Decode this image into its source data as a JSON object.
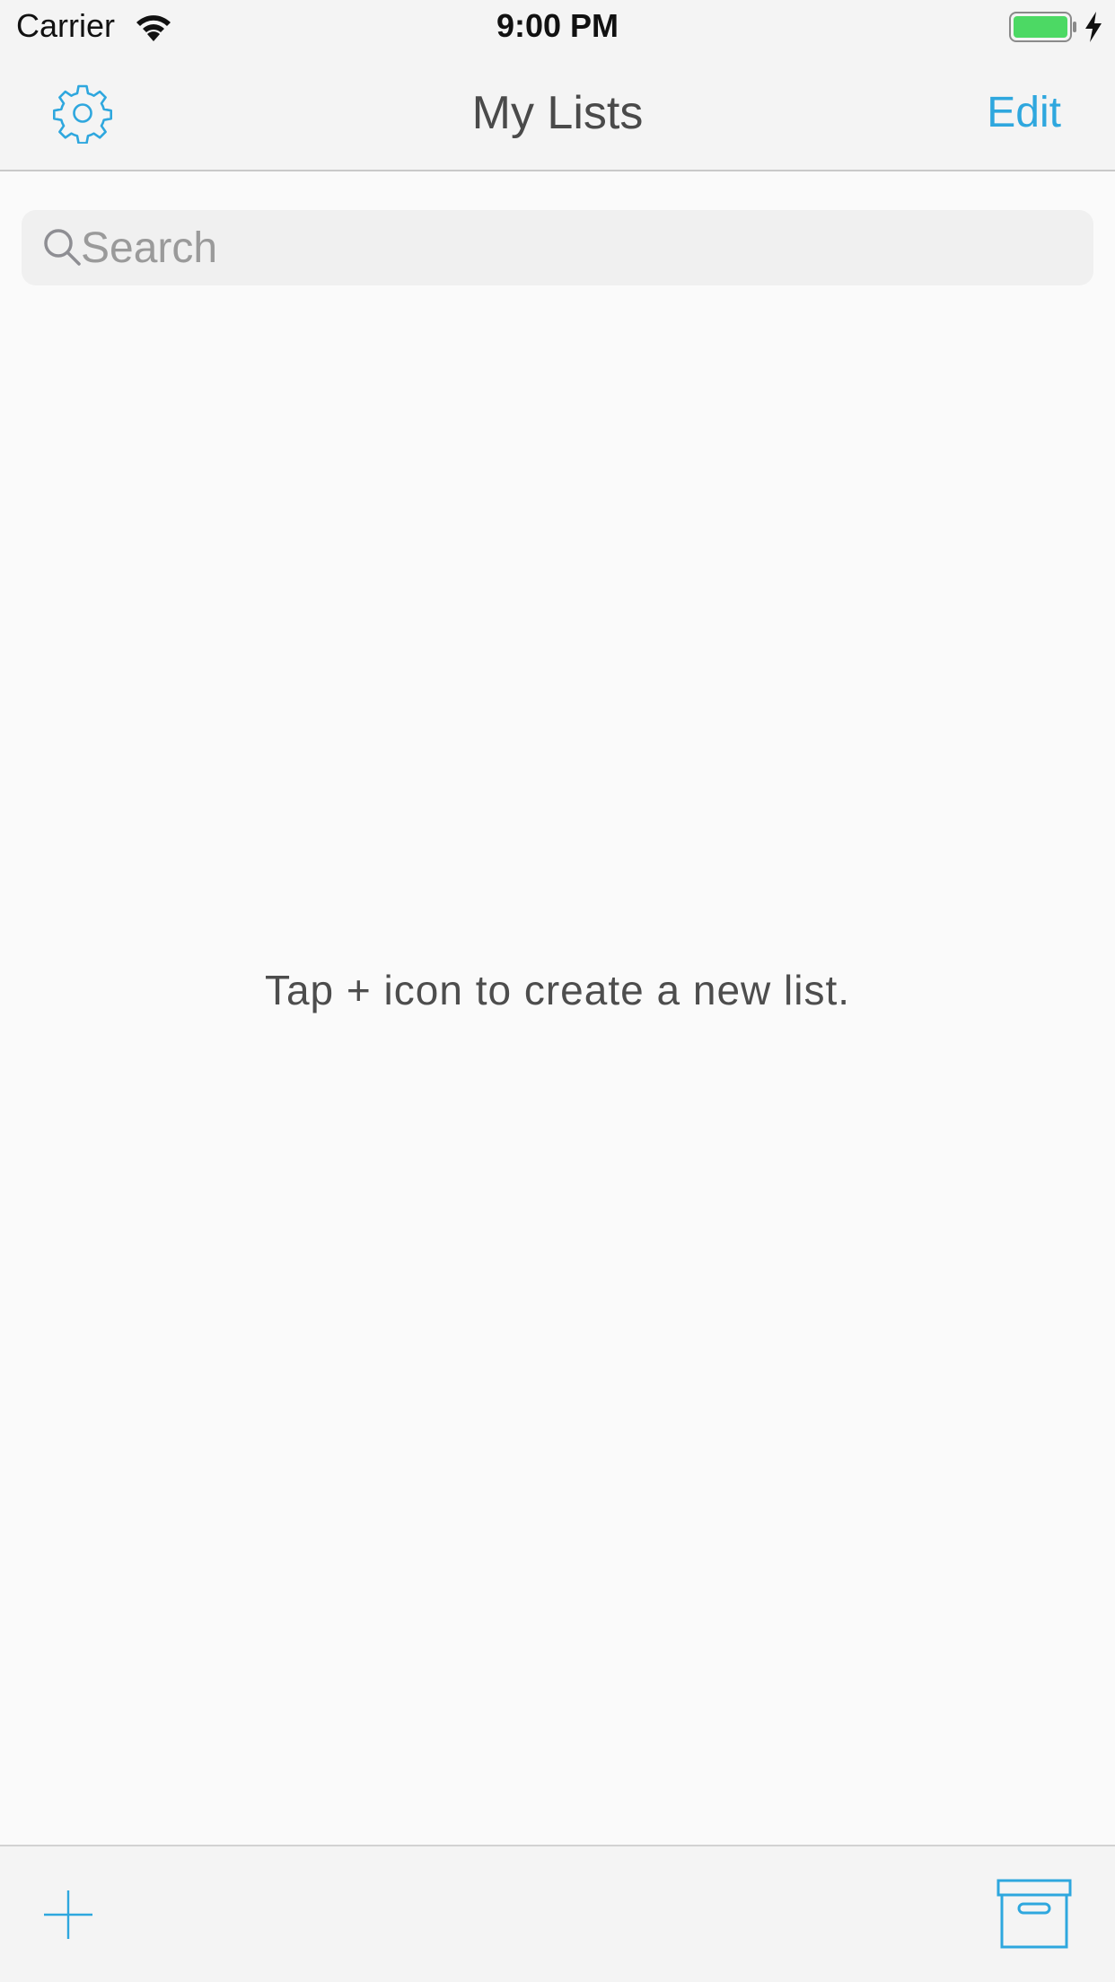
{
  "status_bar": {
    "carrier": "Carrier",
    "time": "9:00 PM",
    "icons": [
      "wifi-icon",
      "battery-icon",
      "charging-bolt-icon"
    ]
  },
  "nav": {
    "title": "My Lists",
    "left_icon": "gear-icon",
    "edit_label": "Edit"
  },
  "search": {
    "placeholder": "Search",
    "icon": "search-icon"
  },
  "empty_state": {
    "message": "Tap + icon to create a new list."
  },
  "toolbar": {
    "left_icon": "plus-icon",
    "right_icon": "archive-box-icon"
  },
  "colors": {
    "accent": "#2ea7de",
    "battery": "#4cd964",
    "bar_background": "#f4f4f4",
    "content_background": "#fafafa"
  }
}
